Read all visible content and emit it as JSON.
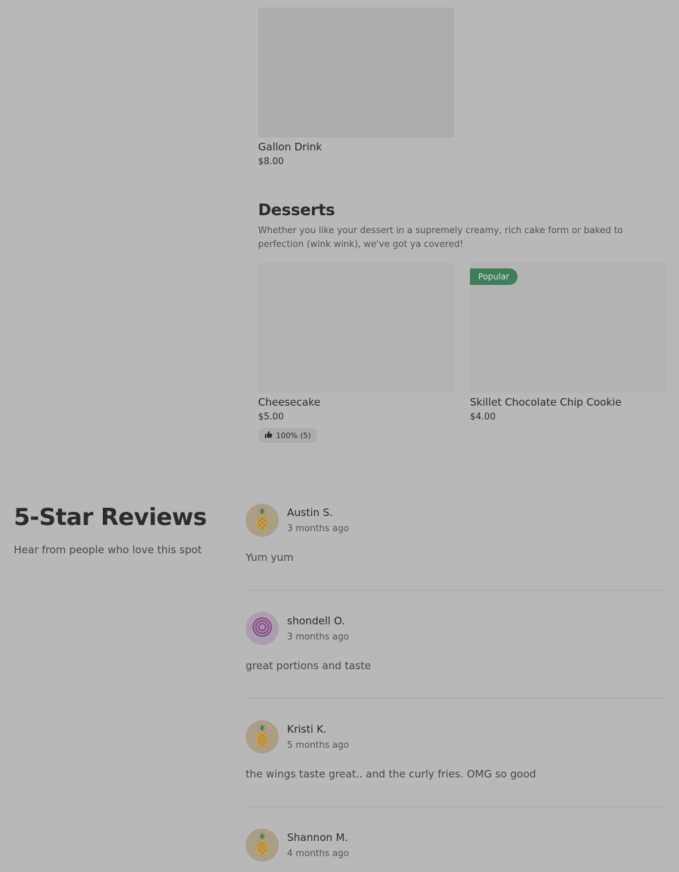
{
  "menu": {
    "prior_items": [
      {
        "name": "Gallon Drink",
        "price": "$8.00"
      }
    ],
    "desserts": {
      "title": "Desserts",
      "description": "Whether you like your dessert in a supremely creamy, rich cake form or baked to perfection (wink wink), we've got ya covered!",
      "items": [
        {
          "name": "Cheesecake",
          "price": "$5.00",
          "rating": "100% (5)"
        },
        {
          "name": "Skillet Chocolate Chip Cookie",
          "price": "$4.00",
          "badge": "Popular"
        }
      ]
    }
  },
  "reviews": {
    "title": "5-Star Reviews",
    "subtitle": "Hear from people who love this spot",
    "items": [
      {
        "name": "Austin S.",
        "time": "3 months ago",
        "text": "Yum yum",
        "avatar_icon": "pineapple-icon"
      },
      {
        "name": "shondell O.",
        "time": "3 months ago",
        "text": "great portions and taste",
        "avatar_icon": "onion-icon"
      },
      {
        "name": "Kristi K.",
        "time": "5 months ago",
        "text": "the wings taste great.. and the curly fries. OMG so good",
        "avatar_icon": "pineapple-icon"
      },
      {
        "name": "Shannon M.",
        "time": "4 months ago",
        "text": "",
        "avatar_icon": "pineapple-icon"
      }
    ]
  },
  "colors": {
    "overlay_background": "#b8b8b8",
    "popular_badge": "#3f7d5b",
    "image_placeholder": "#acacac"
  }
}
